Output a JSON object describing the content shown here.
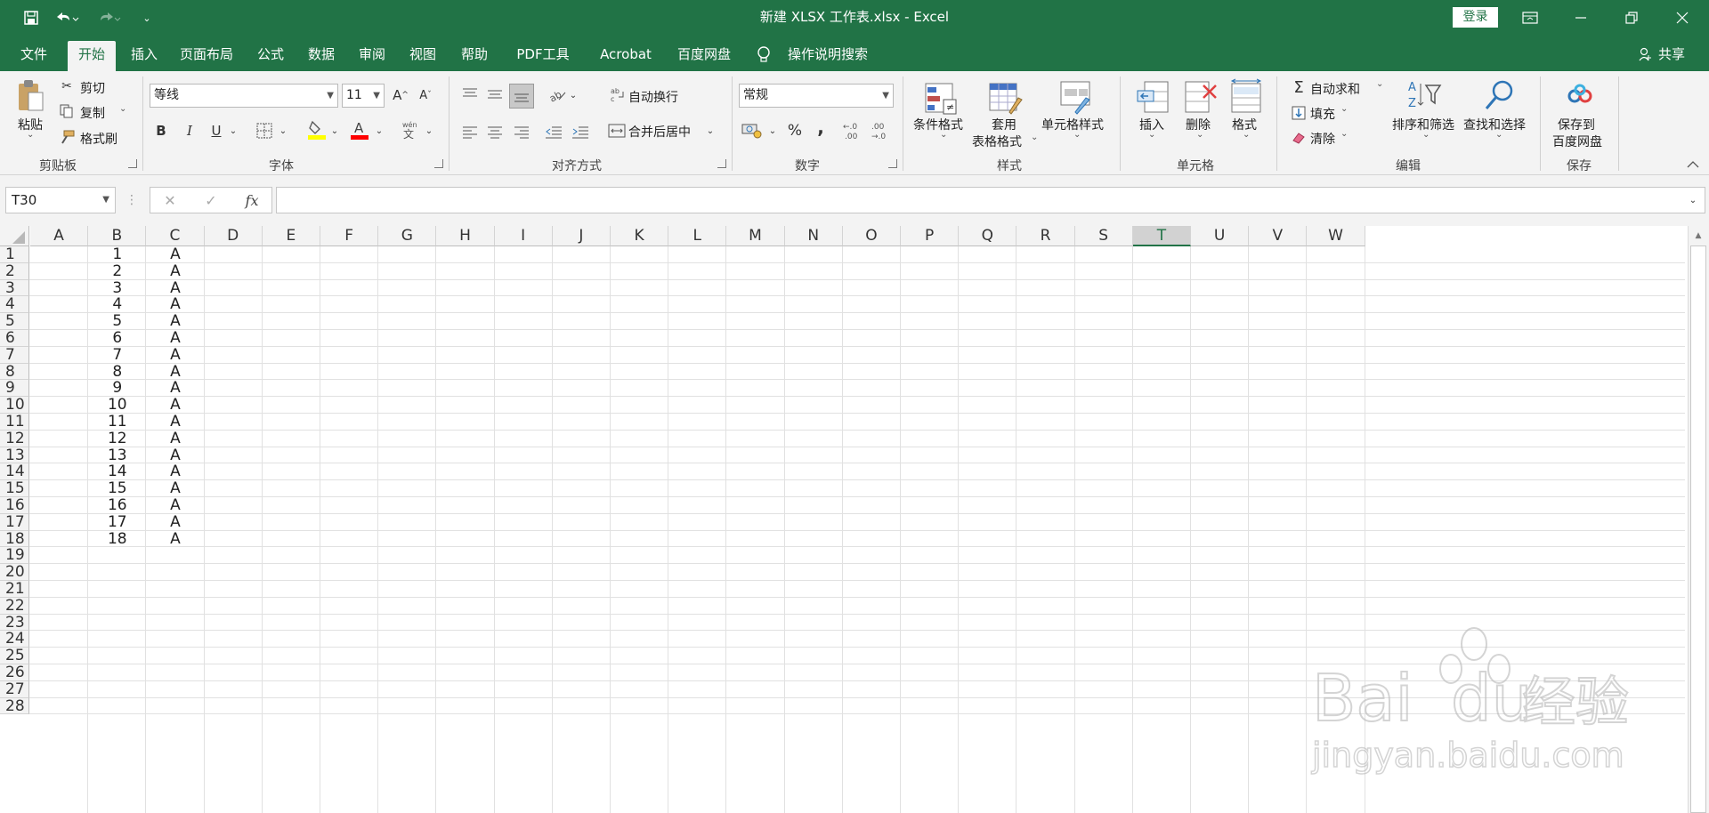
{
  "window": {
    "title": "新建 XLSX 工作表.xlsx  -  Excel",
    "login_label": "登录",
    "quick_access": [
      "save-icon",
      "undo-icon",
      "redo-icon",
      "customize-icon"
    ]
  },
  "tabs": [
    {
      "label": "文件"
    },
    {
      "label": "开始"
    },
    {
      "label": "插入"
    },
    {
      "label": "页面布局"
    },
    {
      "label": "公式"
    },
    {
      "label": "数据"
    },
    {
      "label": "审阅"
    },
    {
      "label": "视图"
    },
    {
      "label": "帮助"
    },
    {
      "label": "PDF工具集"
    },
    {
      "label": "Acrobat"
    },
    {
      "label": "百度网盘"
    },
    {
      "label": "操作说明搜索"
    }
  ],
  "share_label": "共享",
  "ribbon": {
    "clipboard": {
      "paste": "粘贴",
      "cut": "剪切",
      "copy": "复制",
      "format_painter": "格式刷",
      "group": "剪贴板"
    },
    "font": {
      "name": "等线",
      "size": "11",
      "group": "字体",
      "bold": "B",
      "italic": "I",
      "underline": "U"
    },
    "alignment": {
      "wrap": "自动换行",
      "merge": "合并后居中",
      "group": "对齐方式"
    },
    "number": {
      "format": "常规",
      "group": "数字",
      "percent": "%",
      "comma": ","
    },
    "styles": {
      "conditional": "条件格式",
      "table_line1": "套用",
      "table_line2": "表格格式",
      "cell_styles": "单元格样式",
      "group": "样式"
    },
    "cells": {
      "insert": "插入",
      "delete": "删除",
      "format": "格式",
      "group": "单元格"
    },
    "editing": {
      "autosum": "自动求和",
      "fill": "填充",
      "clear": "清除",
      "sort": "排序和筛选",
      "find": "查找和选择",
      "group": "编辑"
    },
    "save": {
      "line1": "保存到",
      "line2": "百度网盘",
      "group": "保存"
    }
  },
  "name_box": "T30",
  "fx_label": "fx",
  "columns": [
    "A",
    "B",
    "C",
    "D",
    "E",
    "F",
    "G",
    "H",
    "I",
    "J",
    "K",
    "L",
    "M",
    "N",
    "O",
    "P",
    "Q",
    "R",
    "S",
    "T",
    "U",
    "V",
    "W"
  ],
  "selected_column": "T",
  "rows": [
    "1",
    "2",
    "3",
    "4",
    "5",
    "6",
    "7",
    "8",
    "9",
    "10",
    "11",
    "12",
    "13",
    "14",
    "15",
    "16",
    "17",
    "18",
    "19",
    "20",
    "21",
    "22",
    "23",
    "24",
    "25",
    "26",
    "27",
    "28"
  ],
  "col_b": [
    "1",
    "2",
    "3",
    "4",
    "5",
    "6",
    "7",
    "8",
    "9",
    "10",
    "11",
    "12",
    "13",
    "14",
    "15",
    "16",
    "17",
    "18"
  ],
  "col_c": [
    "A",
    "A",
    "A",
    "A",
    "A",
    "A",
    "A",
    "A",
    "A",
    "A",
    "A",
    "A",
    "A",
    "A",
    "A",
    "A",
    "A",
    "A"
  ],
  "watermark": {
    "line1": "Bai",
    "line2": "du",
    "cn": "经验",
    "url": "jingyan.baidu.com"
  }
}
